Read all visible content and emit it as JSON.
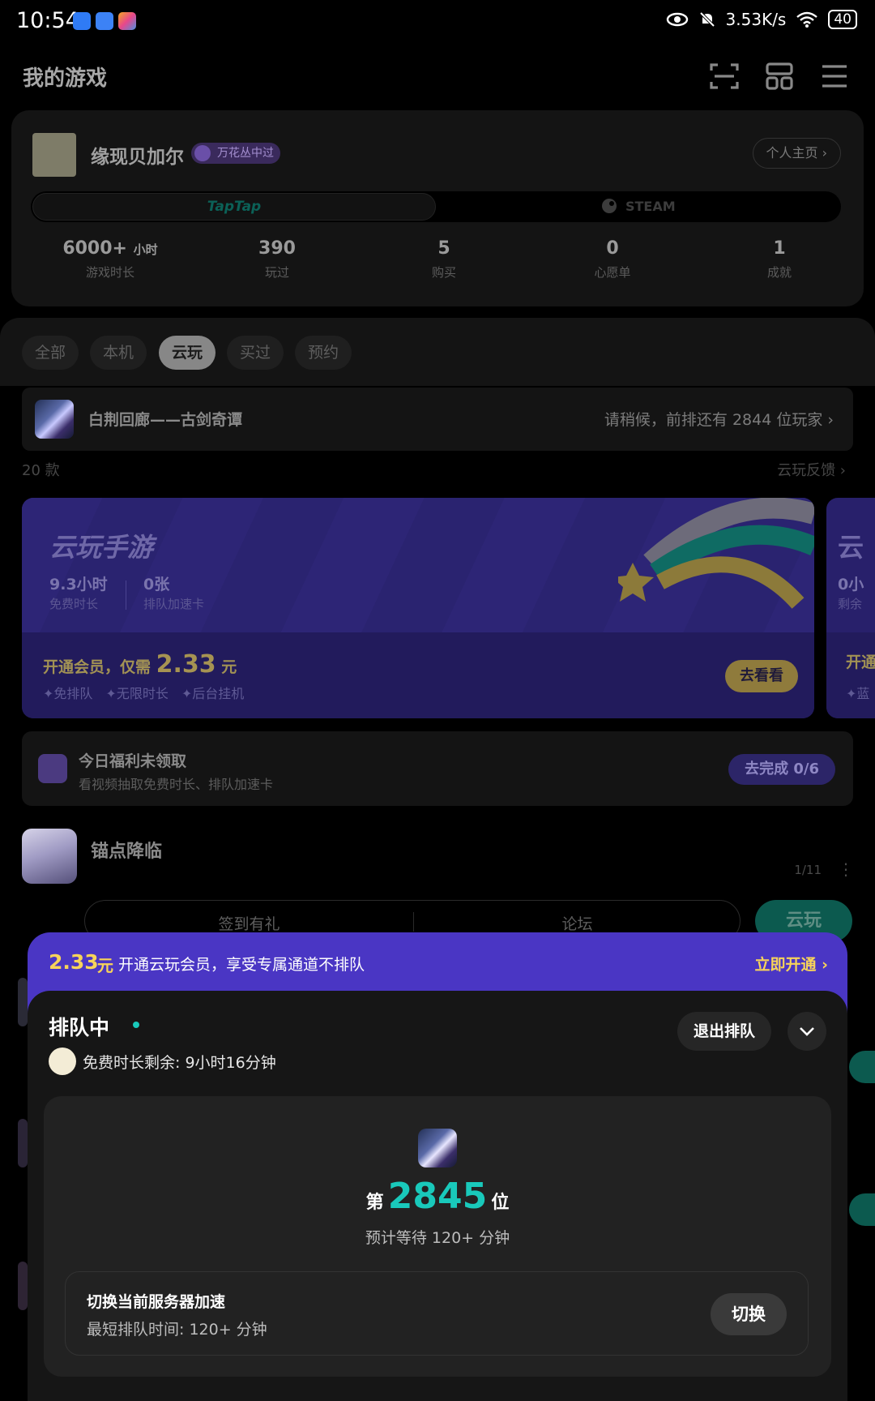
{
  "status_bar": {
    "time": "10:54",
    "network_speed": "3.53K/s",
    "battery": "40"
  },
  "header": {
    "title": "我的游戏"
  },
  "profile": {
    "username": "缘现贝加尔",
    "badge": "万花丛中过",
    "homepage_label": "个人主页 ›",
    "platforms": [
      "TapTap",
      "STEAM"
    ],
    "stats": [
      {
        "value": "6000+",
        "unit": "小时",
        "label": "游戏时长"
      },
      {
        "value": "390",
        "unit": "",
        "label": "玩过"
      },
      {
        "value": "5",
        "unit": "",
        "label": "购买"
      },
      {
        "value": "0",
        "unit": "",
        "label": "心愿单"
      },
      {
        "value": "1",
        "unit": "",
        "label": "成就"
      }
    ]
  },
  "tabs": [
    "全部",
    "本机",
    "云玩",
    "买过",
    "预约"
  ],
  "active_tab": "云玩",
  "queue_strip": {
    "game": "白荆回廊——古剑奇谭",
    "status": "请稍候，前排还有 2844 位玩家 ›"
  },
  "list_meta": {
    "count": "20 款",
    "feedback": "云玩反馈 ›"
  },
  "promo": {
    "title": "云玩手游",
    "free_time_value": "9.3小时",
    "free_time_label": "免费时长",
    "cards_value": "0张",
    "cards_label": "排队加速卡",
    "offer_prefix": "开通会员，仅需",
    "offer_price": "2.33",
    "offer_unit": "元",
    "features": "✦免排队　✦无限时长　✦后台挂机",
    "button": "去看看",
    "peek_title": "云",
    "peek_value": "0小",
    "peek_label": "剩余",
    "peek_offer": "开通",
    "peek_feat": "✦蓝"
  },
  "welfare": {
    "title": "今日福利未领取",
    "subtitle": "看视频抽取免费时长、排队加速卡",
    "button": "去完成 0/6"
  },
  "game_row": {
    "name": "锚点降临",
    "page": "1/11",
    "more": "⋮",
    "actions": [
      "签到有礼",
      "论坛"
    ],
    "cloud_button": "云玩"
  },
  "sheet": {
    "banner_price": "2.33",
    "banner_unit": "元",
    "banner_text": "开通云玩会员，享受专属通道不排队",
    "banner_cta": "立即开通 ›",
    "title": "排队中",
    "free_time": "免费时长剩余: 9小时16分钟",
    "exit_button": "退出排队",
    "rank_prefix": "第",
    "rank": "2845",
    "rank_suffix": "位",
    "wait": "预计等待 120+ 分钟",
    "server_title": "切换当前服务器加速",
    "server_sub": "最短排队时间:  120+ 分钟",
    "switch_button": "切换"
  },
  "colors": {
    "accent_teal": "#19c9bb",
    "banner_purple": "#4a36c4",
    "gold": "#f7d35a"
  }
}
